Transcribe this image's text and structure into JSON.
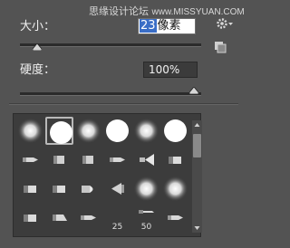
{
  "watermark": {
    "text": "思缘设计论坛",
    "url": "www.MISSYUAN.COM"
  },
  "size": {
    "label": "大小：",
    "value": "23",
    "unit": "像素",
    "level_fraction": 0.08
  },
  "hardness": {
    "label": "硬度：",
    "value": "100%",
    "level_fraction": 1.0
  },
  "brushes": [
    {
      "icon": "soft-round",
      "num": "",
      "selected": false
    },
    {
      "icon": "hard-round",
      "num": "",
      "selected": true
    },
    {
      "icon": "soft-round",
      "num": "",
      "selected": false
    },
    {
      "icon": "hard-round",
      "num": "",
      "selected": false
    },
    {
      "icon": "soft-round",
      "num": "",
      "selected": false
    },
    {
      "icon": "hard-round",
      "num": "",
      "selected": false
    },
    {
      "icon": "pencil",
      "num": "",
      "selected": false
    },
    {
      "icon": "marker",
      "num": "",
      "selected": false
    },
    {
      "icon": "marker",
      "num": "",
      "selected": false
    },
    {
      "icon": "pencil",
      "num": "",
      "selected": false
    },
    {
      "icon": "fan",
      "num": "",
      "selected": false
    },
    {
      "icon": "flat",
      "num": "",
      "selected": false
    },
    {
      "icon": "flat",
      "num": "",
      "selected": false
    },
    {
      "icon": "flat",
      "num": "",
      "selected": false
    },
    {
      "icon": "round-tip",
      "num": "",
      "selected": false
    },
    {
      "icon": "cone",
      "num": "",
      "selected": false
    },
    {
      "icon": "soft-round",
      "num": "",
      "selected": false
    },
    {
      "icon": "soft-round",
      "num": "",
      "selected": false
    },
    {
      "icon": "flat",
      "num": "",
      "selected": false
    },
    {
      "icon": "chisel",
      "num": "",
      "selected": false
    },
    {
      "icon": "pencil",
      "num": "",
      "selected": false
    },
    {
      "icon": "blank",
      "num": "25",
      "selected": false
    },
    {
      "icon": "knife",
      "num": "50",
      "selected": false
    },
    {
      "icon": "pencil",
      "num": "",
      "selected": false
    }
  ],
  "colors": {
    "panel": "#535353",
    "picker_bg": "#3c3c3c",
    "selection_blue": "#3a6ec6"
  },
  "icons": [
    "gear-icon",
    "new-preset-icon"
  ]
}
